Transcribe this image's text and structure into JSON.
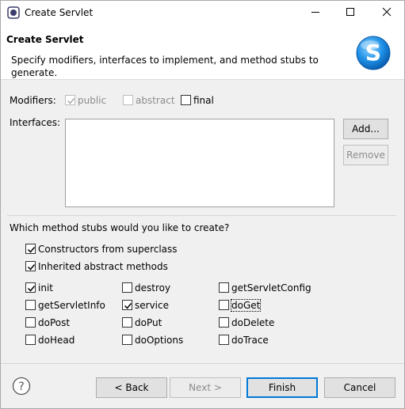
{
  "window": {
    "title": "Create Servlet",
    "minimize_icon": "minimize-icon",
    "maximize_icon": "maximize-icon",
    "close_icon": "close-icon"
  },
  "banner": {
    "title": "Create Servlet",
    "description": "Specify modifiers, interfaces to implement, and method stubs to generate.",
    "logo_icon": "servlet-s-logo-icon",
    "logo_letter": "S"
  },
  "modifiers": {
    "label": "Modifiers:",
    "public": {
      "label": "public",
      "checked": true,
      "enabled": false
    },
    "abstract": {
      "label": "abstract",
      "checked": false,
      "enabled": false
    },
    "final": {
      "label": "final",
      "checked": false,
      "enabled": true
    }
  },
  "interfaces": {
    "label": "Interfaces:",
    "add_label": "Add...",
    "remove_label": "Remove"
  },
  "stubs": {
    "question": "Which method stubs would you like to create?",
    "constructors": {
      "label": "Constructors from superclass",
      "checked": true
    },
    "inherited": {
      "label": "Inherited abstract methods",
      "checked": true
    },
    "methods": [
      {
        "label": "init",
        "checked": true
      },
      {
        "label": "destroy",
        "checked": false
      },
      {
        "label": "getServletConfig",
        "checked": false
      },
      {
        "label": "getServletInfo",
        "checked": false
      },
      {
        "label": "service",
        "checked": true
      },
      {
        "label": "doGet",
        "checked": false
      },
      {
        "label": "doPost",
        "checked": false
      },
      {
        "label": "doPut",
        "checked": false
      },
      {
        "label": "doDelete",
        "checked": false
      },
      {
        "label": "doHead",
        "checked": false
      },
      {
        "label": "doOptions",
        "checked": false
      },
      {
        "label": "doTrace",
        "checked": false
      }
    ]
  },
  "footer": {
    "help_icon": "help-icon",
    "back_label": "< Back",
    "next_label": "Next >",
    "finish_label": "Finish",
    "cancel_label": "Cancel"
  }
}
